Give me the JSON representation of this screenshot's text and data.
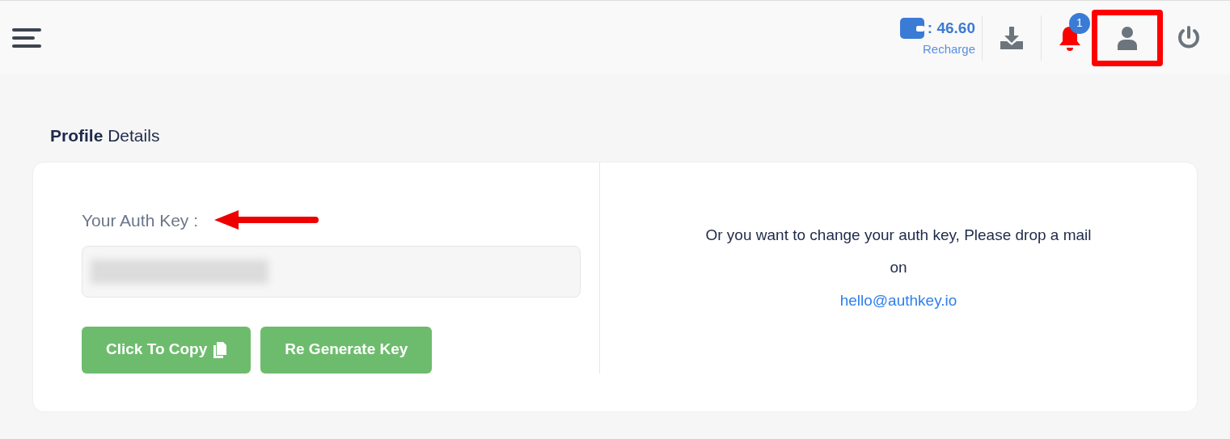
{
  "header": {
    "balance": ": 46.60",
    "recharge": "Recharge",
    "notification_count": "1",
    "profile_highlighted": true
  },
  "title": "**Profile** Details",
  "auth_key": {
    "label": "Your Auth Key :",
    "redacted": true,
    "pointer_arrow": true
  },
  "buttons": [
    {
      "kind": "copy",
      "label": "Click To Copy"
    },
    {
      "kind": "regenerate",
      "label": "Re Generate Key"
    }
  ],
  "help": {
    "message": "Or you want to change your auth key, Please drop a mail",
    "on": "on",
    "email": "hello@authkey.io"
  }
}
